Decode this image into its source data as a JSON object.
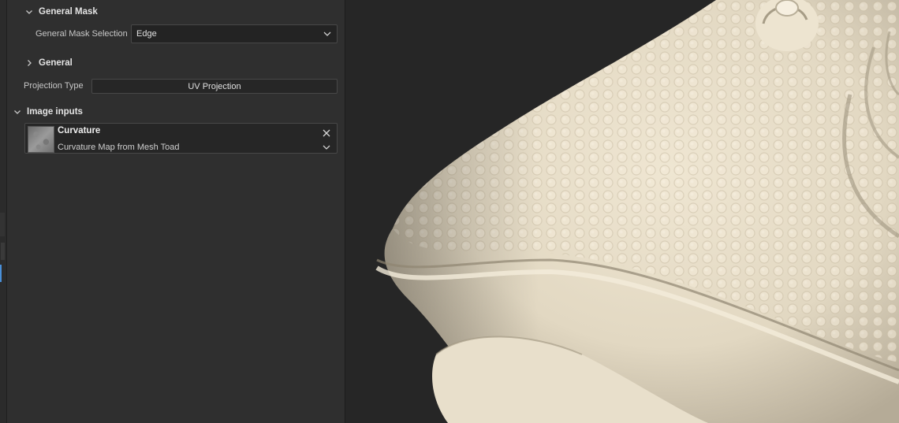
{
  "general_mask": {
    "header": "General Mask",
    "selection_label": "General Mask Selection",
    "selection_value": "Edge"
  },
  "general": {
    "header": "General",
    "projection_label": "Projection Type",
    "projection_value": "UV Projection"
  },
  "image_inputs": {
    "header": "Image inputs",
    "item": {
      "title": "Curvature",
      "subtitle": "Curvature Map from Mesh Toad"
    }
  },
  "icons": {
    "expanded": "chevron-down-icon",
    "collapsed": "chevron-right-icon",
    "remove": "close-icon",
    "dropdown": "chevron-down-icon"
  },
  "colors": {
    "panel_bg": "#2f2f2f",
    "viewport_bg": "#262626",
    "model_color": "#e6ddc8",
    "accent": "#4a90d9"
  }
}
